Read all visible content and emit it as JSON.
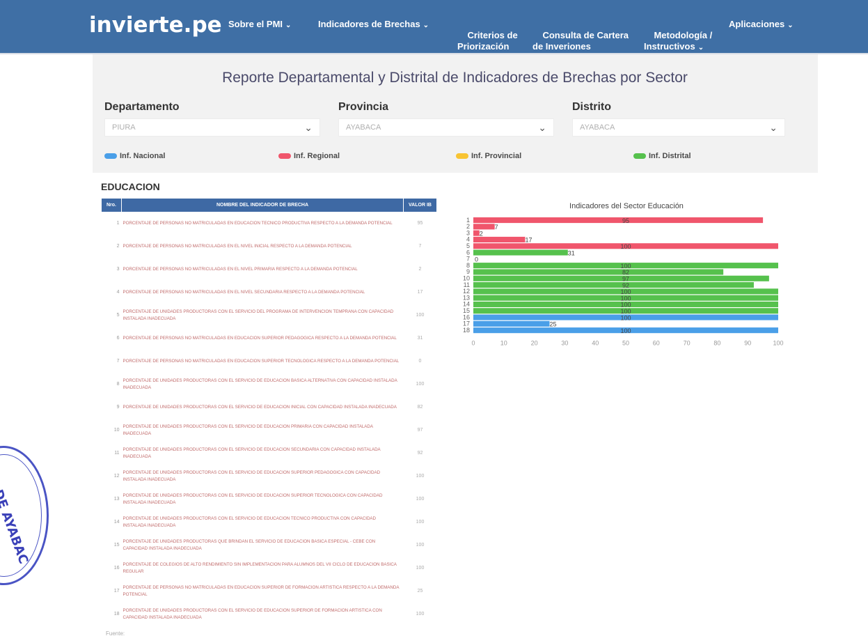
{
  "nav": {
    "logo": "invierte.pe",
    "items": [
      {
        "label": "Sobre el PMI",
        "dropdown": true
      },
      {
        "label": "Indicadores de Brechas",
        "dropdown": true
      },
      {
        "label": "Criterios de\nPriorización",
        "dropdown": false
      },
      {
        "label": "Consulta de Cartera\nde Inveriones",
        "dropdown": false
      },
      {
        "label": "Metodología /\nInstructivos",
        "dropdown": true
      },
      {
        "label": "Aplicaciones",
        "dropdown": true
      }
    ]
  },
  "report_title": "Reporte Departamental y Distrital de Indicadores de Brechas por Sector",
  "filters": {
    "departamento": {
      "label": "Departamento",
      "value": "PIURA"
    },
    "provincia": {
      "label": "Provincia",
      "value": "AYABACA"
    },
    "distrito": {
      "label": "Distrito",
      "value": "AYABACA"
    }
  },
  "legend": [
    {
      "label": "Inf. Nacional",
      "color": "#4a9fe8"
    },
    {
      "label": "Inf. Regional",
      "color": "#f0566c"
    },
    {
      "label": "Inf. Provincial",
      "color": "#f8c433"
    },
    {
      "label": "Inf. Distrital",
      "color": "#56c14d"
    }
  ],
  "section": "EDUCACION",
  "table": {
    "headers": [
      "Nro.",
      "NOMBRE DEL INDICADOR DE BRECHA",
      "VALOR IB"
    ],
    "rows": [
      {
        "nro": "1",
        "name": "PORCENTAJE DE PERSONAS NO MATRICULADAS EN EDUCACION TECNICO PRODUCTIVA RESPECTO A LA DEMANDA POTENCIAL",
        "value": "95"
      },
      {
        "nro": "2",
        "name": "PORCENTAJE DE PERSONAS NO MATRICULADAS EN EL NIVEL INICIAL RESPECTO A LA DEMANDA POTENCIAL",
        "value": "7"
      },
      {
        "nro": "3",
        "name": "PORCENTAJE DE PERSONAS NO MATRICULADAS EN EL NIVEL PRIMARIA RESPECTO A LA DEMANDA POTENCIAL",
        "value": "2"
      },
      {
        "nro": "4",
        "name": "PORCENTAJE DE PERSONAS NO MATRICULADAS EN EL NIVEL SECUNDARIA RESPECTO A LA DEMANDA POTENCIAL",
        "value": "17"
      },
      {
        "nro": "5",
        "name": "PORCENTAJE DE UNIDADES PRODUCTORAS CON EL SERVICIO DEL PROGRAMA DE INTERVENCION TEMPRANA CON CAPACIDAD INSTALADA INADECUADA",
        "value": "100"
      },
      {
        "nro": "6",
        "name": "PORCENTAJE DE PERSONAS NO MATRICULADAS EN EDUCACION SUPERIOR PEDAGOGICA RESPECTO A LA DEMANDA POTENCIAL",
        "value": "31"
      },
      {
        "nro": "7",
        "name": "PORCENTAJE DE PERSONAS NO MATRICULADAS EN EDUCACION SUPERIOR TECNOLOGICA RESPECTO A LA DEMANDA POTENCIAL",
        "value": "0"
      },
      {
        "nro": "8",
        "name": "PORCENTAJE DE UNIDADES PRODUCTORAS CON EL SERVICIO DE EDUCACION BASICA ALTERNATIVA CON CAPACIDAD INSTALADA INADECUADA",
        "value": "100"
      },
      {
        "nro": "9",
        "name": "PORCENTAJE DE UNIDADES PRODUCTORAS CON EL SERVICIO DE EDUCACION INICIAL CON CAPACIDAD INSTALADA INADECUADA",
        "value": "82"
      },
      {
        "nro": "10",
        "name": "PORCENTAJE DE UNIDADES PRODUCTORAS CON EL SERVICIO DE EDUCACION PRIMARIA CON CAPACIDAD INSTALADA INADECUADA",
        "value": "97"
      },
      {
        "nro": "11",
        "name": "PORCENTAJE DE UNIDADES PRODUCTORAS CON EL SERVICIO DE EDUCACION SECUNDARIA CON CAPACIDAD INSTALADA INADECUADA",
        "value": "92"
      },
      {
        "nro": "12",
        "name": "PORCENTAJE DE UNIDADES PRODUCTORAS CON EL SERVICIO DE EDUCACION SUPERIOR PEDAGOGICA CON CAPACIDAD INSTALADA INADECUADA",
        "value": "100"
      },
      {
        "nro": "13",
        "name": "PORCENTAJE DE UNIDADES PRODUCTORAS CON EL SERVICIO DE EDUCACION SUPERIOR TECNOLOGICA CON CAPACIDAD INSTALADA INADECUADA",
        "value": "100"
      },
      {
        "nro": "14",
        "name": "PORCENTAJE DE UNIDADES PRODUCTORAS CON EL SERVICIO DE EDUCACION TECNICO PRODUCTIVA CON CAPACIDAD INSTALADA INADECUADA",
        "value": "100"
      },
      {
        "nro": "15",
        "name": "PORCENTAJE DE UNIDADES PRODUCTORAS QUE BRINDAN EL SERVICIO DE EDUCACION BASICA ESPECIAL - CEBE CON CAPACIDAD INSTALADA INADECUADA",
        "value": "100"
      },
      {
        "nro": "16",
        "name": "PORCENTAJE DE COLEGIOS DE ALTO RENDIMIENTO SIN IMPLEMENTACION PARA ALUMNOS DEL VII CICLO DE EDUCACION BASICA REGULAR",
        "value": "100"
      },
      {
        "nro": "17",
        "name": "PORCENTAJE DE PERSONAS NO MATRICULADAS EN EDUCACION SUPERIOR DE FORMACION ARTISTICA RESPECTO A LA DEMANDA POTENCIAL",
        "value": "25"
      },
      {
        "nro": "18",
        "name": "PORCENTAJE DE UNIDADES PRODUCTORAS CON EL SERVICIO DE EDUCACION SUPERIOR DE FORMACION ARTISTICA CON CAPACIDAD INSTALADA INADECUADA",
        "value": "100"
      }
    ]
  },
  "footer": "Fuente:",
  "stamp_text": "DE AYABAC",
  "chart_data": {
    "type": "bar",
    "orientation": "horizontal",
    "title": "Indicadores del Sector Educación",
    "categories": [
      "1",
      "2",
      "3",
      "4",
      "5",
      "6",
      "7",
      "8",
      "9",
      "10",
      "11",
      "12",
      "13",
      "14",
      "15",
      "16",
      "17",
      "18"
    ],
    "values": [
      95,
      7,
      2,
      17,
      100,
      31,
      0,
      100,
      82,
      97,
      92,
      100,
      100,
      100,
      100,
      100,
      25,
      100
    ],
    "bar_colors": [
      "#f0566c",
      "#f0566c",
      "#f0566c",
      "#f0566c",
      "#f0566c",
      "#56c14d",
      "#56c14d",
      "#56c14d",
      "#56c14d",
      "#56c14d",
      "#56c14d",
      "#56c14d",
      "#56c14d",
      "#56c14d",
      "#56c14d",
      "#4a9fe8",
      "#4a9fe8",
      "#4a9fe8"
    ],
    "xticks": [
      0,
      10,
      20,
      30,
      40,
      50,
      60,
      70,
      80,
      90,
      100
    ],
    "xlim": [
      0,
      100
    ],
    "grid": false
  }
}
